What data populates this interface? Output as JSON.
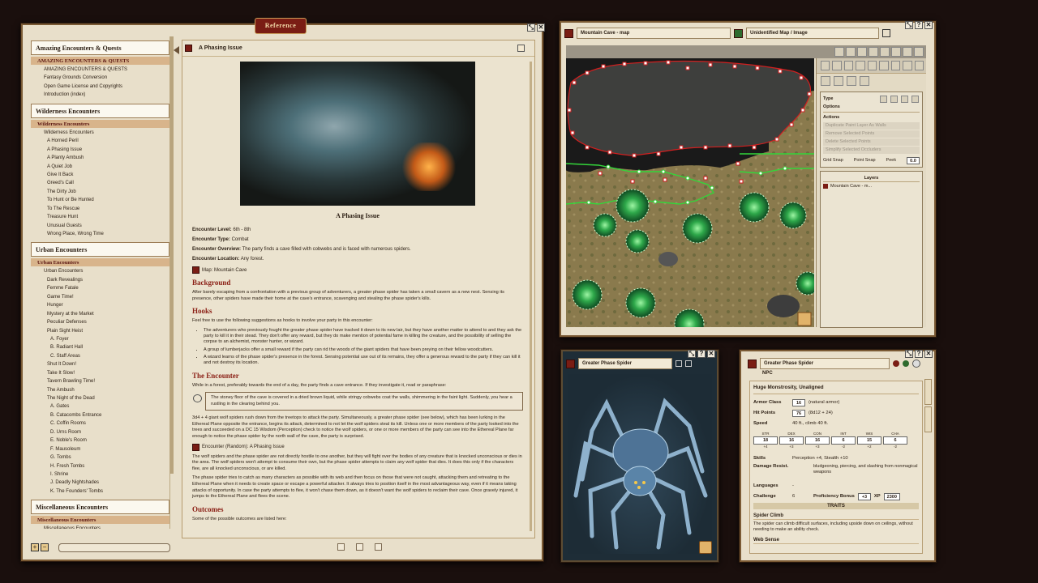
{
  "reference": {
    "tab_label": "Reference",
    "toc": [
      {
        "type": "h",
        "text": "Amazing Encounters & Quests"
      },
      {
        "type": "s",
        "text": "AMAZING ENCOUNTERS & QUESTS"
      },
      {
        "type": "i",
        "level": 1,
        "text": "AMAZING ENCOUNTERS & QUESTS"
      },
      {
        "type": "i",
        "level": 1,
        "text": "Fantasy Grounds Conversion"
      },
      {
        "type": "i",
        "level": 1,
        "text": "Open Game License and Copyrights"
      },
      {
        "type": "i",
        "level": 1,
        "text": "Introduction (index)"
      },
      {
        "type": "h",
        "text": "Wilderness Encounters"
      },
      {
        "type": "s",
        "text": "Wilderness Encounters"
      },
      {
        "type": "i",
        "level": 1,
        "text": "Wilderness Encounters"
      },
      {
        "type": "i",
        "level": 2,
        "text": "A Horned Peril"
      },
      {
        "type": "i",
        "level": 2,
        "text": "A Phasing Issue"
      },
      {
        "type": "i",
        "level": 2,
        "text": "A Planty Ambush"
      },
      {
        "type": "i",
        "level": 2,
        "text": "A Quiet Job"
      },
      {
        "type": "i",
        "level": 2,
        "text": "Give It Back"
      },
      {
        "type": "i",
        "level": 2,
        "text": "Greed's Call"
      },
      {
        "type": "i",
        "level": 2,
        "text": "The Dirty Job"
      },
      {
        "type": "i",
        "level": 2,
        "text": "To Hunt or Be Hunted"
      },
      {
        "type": "i",
        "level": 2,
        "text": "To The Rescue"
      },
      {
        "type": "i",
        "level": 2,
        "text": "Treasure Hunt"
      },
      {
        "type": "i",
        "level": 2,
        "text": "Unusual Guests"
      },
      {
        "type": "i",
        "level": 2,
        "text": "Wrong Place, Wrong Time"
      },
      {
        "type": "h",
        "text": "Urban Encounters"
      },
      {
        "type": "s",
        "text": "Urban Encounters"
      },
      {
        "type": "i",
        "level": 1,
        "text": "Urban Encounters"
      },
      {
        "type": "i",
        "level": 2,
        "text": "Dark Revealings"
      },
      {
        "type": "i",
        "level": 2,
        "text": "Femme Fatale"
      },
      {
        "type": "i",
        "level": 2,
        "text": "Game Time!"
      },
      {
        "type": "i",
        "level": 2,
        "text": "Hunger"
      },
      {
        "type": "i",
        "level": 2,
        "text": "Mystery at the Market"
      },
      {
        "type": "i",
        "level": 2,
        "text": "Peculiar Defenses"
      },
      {
        "type": "i",
        "level": 2,
        "text": "Plain Sight Heist"
      },
      {
        "type": "i",
        "level": 3,
        "text": "A. Foyer"
      },
      {
        "type": "i",
        "level": 3,
        "text": "B. Radiant Hall"
      },
      {
        "type": "i",
        "level": 3,
        "text": "C. Staff Areas"
      },
      {
        "type": "i",
        "level": 2,
        "text": "Shut It Down!"
      },
      {
        "type": "i",
        "level": 2,
        "text": "Take It Slow!"
      },
      {
        "type": "i",
        "level": 2,
        "text": "Tavern Brawling Time!"
      },
      {
        "type": "i",
        "level": 2,
        "text": "The Ambush"
      },
      {
        "type": "i",
        "level": 2,
        "text": "The Night of the Dead"
      },
      {
        "type": "i",
        "level": 3,
        "text": "A. Gates"
      },
      {
        "type": "i",
        "level": 3,
        "text": "B. Catacombs Entrance"
      },
      {
        "type": "i",
        "level": 3,
        "text": "C. Coffin Rooms"
      },
      {
        "type": "i",
        "level": 3,
        "text": "D. Urns Room"
      },
      {
        "type": "i",
        "level": 3,
        "text": "E. Noble's Room"
      },
      {
        "type": "i",
        "level": 3,
        "text": "F. Mausoleum"
      },
      {
        "type": "i",
        "level": 3,
        "text": "G. Tombs"
      },
      {
        "type": "i",
        "level": 3,
        "text": "H. Fresh Tombs"
      },
      {
        "type": "i",
        "level": 3,
        "text": "I. Shrine"
      },
      {
        "type": "i",
        "level": 3,
        "text": "J. Deadly Nightshades"
      },
      {
        "type": "i",
        "level": 3,
        "text": "K. The Founders' Tombs"
      },
      {
        "type": "h",
        "text": "Miscellaneous Encounters"
      },
      {
        "type": "s",
        "text": "Miscellaneous Encounters"
      },
      {
        "type": "i",
        "level": 1,
        "text": "Miscellaneous Encounters"
      }
    ],
    "doc": {
      "header": "A Phasing Issue",
      "caption": "A Phasing Issue",
      "fields": [
        {
          "label": "Encounter Level:",
          "value": "6th - 8th"
        },
        {
          "label": "Encounter Type:",
          "value": "Combat"
        },
        {
          "label": "Encounter Overview:",
          "value": "The party finds a cave filled with cobwebs and is faced with numerous spiders."
        },
        {
          "label": "Encounter Location:",
          "value": "Any forest."
        }
      ],
      "map_link": "Map: Mountain Cave",
      "background_title": "Background",
      "background_text": "After barely escaping from a confrontation with a previous group of adventurers, a greater phase spider has taken a small cavern as a new nest. Sensing its presence, other spiders have made their home at the cave's entrance, scavenging and stealing the phase spider's kills.",
      "hooks_title": "Hooks",
      "hooks_intro": "Feel free to use the following suggestions as hooks to involve your party in this encounter:",
      "hooks": [
        "The adventurers who previously fought the greater phase spider have tracked it down to its new lair, but they have another matter to attend to and they ask the party to kill it in their stead. They don't offer any reward, but they do make mention of potential fame in killing the creature, and the possibility of selling the corpse to an alchemist, monster hunter, or wizard.",
        "A group of lumberjacks offer a small reward if the party can rid the woods of the giant spiders that have been preying on their fellow woodcutters.",
        "A wizard learns of the phase spider's presence in the forest. Sensing potential use out of its remains, they offer a generous reward to the party if they can kill it and not destroy its location."
      ],
      "encounter_title": "The Encounter",
      "encounter_intro": "While in a forest, preferably towards the end of a day, the party finds a cave entrance. If they investigate it, read or paraphrase:",
      "quote": "The stoney floor of the cave is covered in a dried brown liquid, while stringy cobwebs coat the walls, shimmering in the faint light. Suddenly, you hear a rustling in the clearing behind you.",
      "encounter_p1": "3d4 + 4 giant wolf spiders rush down from the treetops to attack the party. Simultaneously, a greater phase spider (see below), which has been lurking in the Ethereal Plane opposite the entrance, begins its attack, determined to not let the wolf spiders steal its kill. Unless one or more members of the party looked into the trees and succeeded on a DC 15 Wisdom (Perception) check to notice the wolf spiders, or one or more members of the party can see into the Ethereal Plane far enough to notice the phase spider by the north wall of the cave, the party is surprised.",
      "encounter_link": "Encounter (Random): A Phasing Issue",
      "encounter_p2": "The wolf spiders and the phase spider are not directly hostile to one another, but they will fight over the bodies of any creature that is knocked unconscious or dies in the area. The wolf spiders won't attempt to consume their own, but the phase spider attempts to claim any wolf spider that dies. It does this only if the characters flee, are all knocked unconscious, or are killed.",
      "encounter_p3": "The phase spider tries to catch as many characters as possible with its web and then focus on those that were not caught, attacking them and retreating to the Ethereal Plane when it needs to create space or escape a powerful attacker. It always tries to position itself in the most advantageous way, even if it means taking attacks of opportunity. In case the party attempts to flee, it won't chase them down, as it doesn't want the wolf spiders to reclaim their cave. Once gravely injured, it jumps to the Ethereal Plane and flees the scene.",
      "outcomes_title": "Outcomes",
      "outcomes_intro": "Some of the possible outcomes are listed here:"
    }
  },
  "map_window": {
    "title": "Mountain Cave - map",
    "subtitle": "Unidentified Map / Image",
    "type_label": "Type",
    "options_label": "Options",
    "actions_label": "Actions",
    "actions": [
      "Duplicate Paint Layer As Walls",
      "Remove Selected Points",
      "Delete Selected Points",
      "Simplify Selected Occluders"
    ],
    "grid_snap": "Grid Snap",
    "point_snap": "Point Snap",
    "peek_label": "Peek",
    "peek_value": "0.0",
    "layers_label": "Layers",
    "layer_item": "Mountain Cave - m..."
  },
  "spider_window": {
    "title": "Greater Phase Spider"
  },
  "npc_window": {
    "title": "Greater Phase Spider",
    "tab": "NPC",
    "type": "Huge Monstrosity, Unaligned",
    "ac_label": "Armor Class",
    "ac": "16",
    "ac_note": "(natural armor)",
    "hp_label": "Hit Points",
    "hp": "76",
    "hp_note": "(8d12 + 24)",
    "speed_label": "Speed",
    "speed": "40 ft., climb 40 ft.",
    "abilities": [
      {
        "name": "STR",
        "score": "18",
        "mod": "+4"
      },
      {
        "name": "DEX",
        "score": "16",
        "mod": "+3"
      },
      {
        "name": "CON",
        "score": "16",
        "mod": "+3"
      },
      {
        "name": "INT",
        "score": "6",
        "mod": "-2"
      },
      {
        "name": "WIS",
        "score": "15",
        "mod": "+2"
      },
      {
        "name": "CHA",
        "score": "6",
        "mod": "-2"
      }
    ],
    "skills_label": "Skills",
    "skills": "Perception +4, Stealth +10",
    "dmg_label": "Damage Resist.",
    "dmg": "bludgeoning, piercing, and slashing from nonmagical weapons",
    "lang_label": "Languages",
    "lang": "-",
    "chal_label": "Challenge",
    "chal": "6",
    "prof_label": "Proficiency Bonus",
    "prof": "+3",
    "xp_label": "XP",
    "xp": "2300",
    "traits_label": "TRAITS",
    "trait1_name": "Spider Climb",
    "trait1_text": "The spider can climb difficult surfaces, including upside down on ceilings, without needing to make an ability check.",
    "trait2_name": "Web Sense"
  },
  "colors": {
    "accent": "#7a1d14",
    "parchment": "#e8dfca",
    "heading": "#8a1e14",
    "green_line": "#33d63a",
    "red_line": "#d21f1f"
  }
}
